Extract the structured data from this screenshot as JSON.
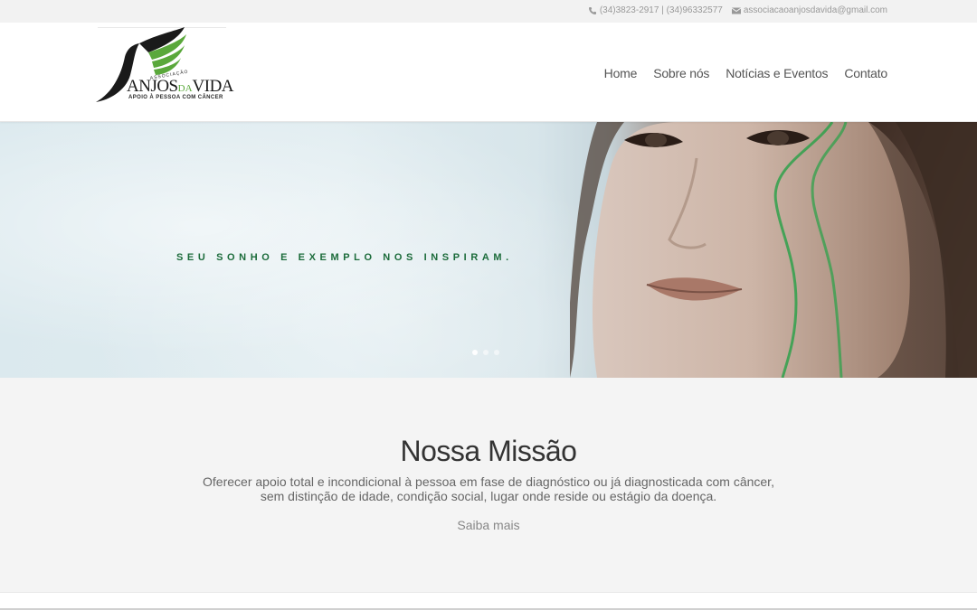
{
  "topbar": {
    "phone_icon": "phone-icon",
    "phone": "(34)3823-2917 | (34)96332577",
    "email_icon": "envelope-icon",
    "email": "associacaoanjosdavida@gmail.com"
  },
  "header": {
    "logo": {
      "assoc": "ASSOCIAÇÃO",
      "brand_a": "ANJOS",
      "brand_da": "DA",
      "brand_b": "VIDA",
      "tagline": "APOIO À PESSOA COM CÂNCER"
    },
    "nav": [
      {
        "label": "Home"
      },
      {
        "label": "Sobre nós"
      },
      {
        "label": "Notícias e Eventos"
      },
      {
        "label": "Contato"
      }
    ]
  },
  "hero": {
    "slogan": "SEU SONHO E EXEMPLO NOS INSPIRAM.",
    "slides": 3,
    "active_slide": 1
  },
  "mission": {
    "title": "Nossa Missão",
    "text": "Oferecer apoio total e incondicional à pessoa em fase de diagnóstico ou já diagnosticada com câncer, sem distinção de idade, condição social, lugar onde reside ou estágio da doença.",
    "link": "Saiba mais"
  },
  "colors": {
    "accent_green": "#1b6b3a",
    "logo_green": "#5aa83b"
  }
}
